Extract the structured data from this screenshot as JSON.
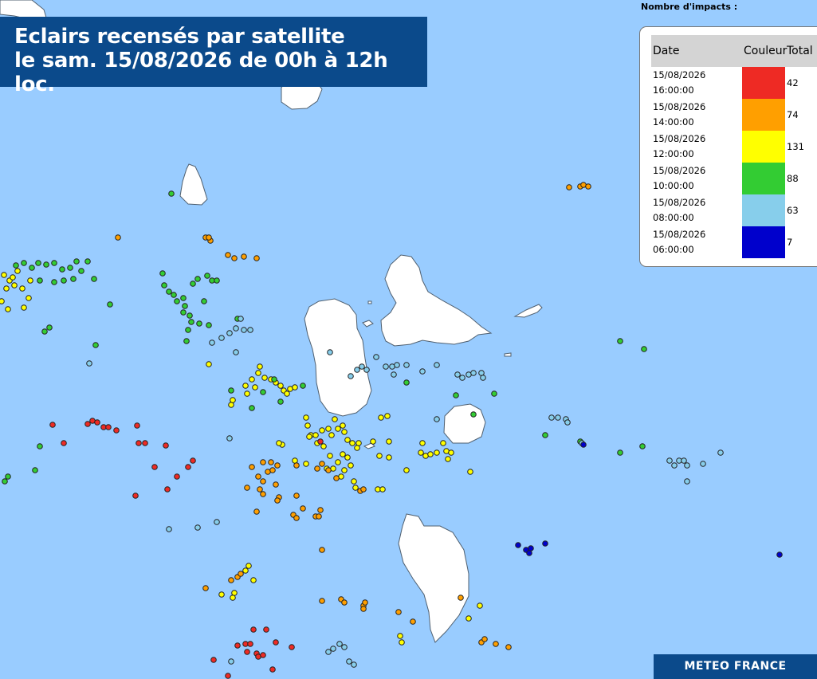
{
  "title": {
    "line1": "Eclairs recensés par satellite",
    "line2": "le sam. 15/08/2026 de 00h à 12h loc."
  },
  "legend": {
    "caption": "Nombre d'impacts :",
    "col_date": "Date",
    "col_color": "Couleur",
    "col_total": "Total",
    "rows": [
      {
        "date": "15/08/2026",
        "time": "16:00:00",
        "color": "#ee2a24",
        "total": "42"
      },
      {
        "date": "15/08/2026",
        "time": "14:00:00",
        "color": "#ff9f00",
        "total": "74"
      },
      {
        "date": "15/08/2026",
        "time": "12:00:00",
        "color": "#ffff00",
        "total": "131"
      },
      {
        "date": "15/08/2026",
        "time": "10:00:00",
        "color": "#33cc33",
        "total": "88"
      },
      {
        "date": "15/08/2026",
        "time": "08:00:00",
        "color": "#87ceeb",
        "total": "63"
      },
      {
        "date": "15/08/2026",
        "time": "06:00:00",
        "color": "#0000cc",
        "total": "7"
      }
    ]
  },
  "brand": "METEO FRANCE",
  "colors": {
    "sea": "#99ccff",
    "land": "#ffffff",
    "banner": "#0b4a8b"
  }
}
